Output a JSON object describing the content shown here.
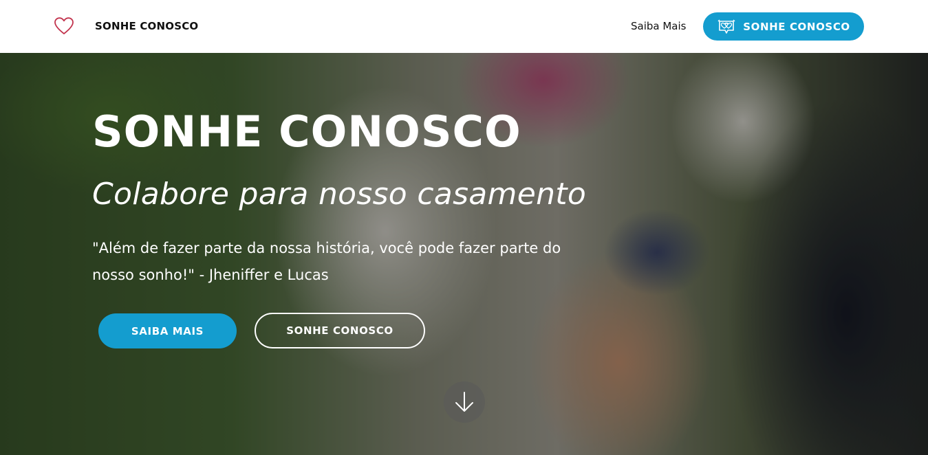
{
  "header": {
    "brand": "SONHE CONOSCO",
    "logo_icon": "heart-outline-icon",
    "nav_link": "Saiba Mais",
    "cta_label": "SONHE CONOSCO",
    "cta_icon": "double-heart-sign-icon"
  },
  "hero": {
    "title": "SONHE CONOSCO",
    "subtitle": "Colabore para nosso casamento",
    "quote": "\"Além de fazer parte da nossa história, você pode fazer parte do nosso sonho!\" - Jheniffer e Lucas",
    "primary_button": "SAIBA MAIS",
    "secondary_button": "SONHE CONOSCO",
    "scroll_icon": "arrow-down-icon"
  },
  "colors": {
    "accent": "#149dcf",
    "logo_heart": "#c2334d",
    "header_bg": "#ffffff",
    "text_dark": "#111111"
  }
}
